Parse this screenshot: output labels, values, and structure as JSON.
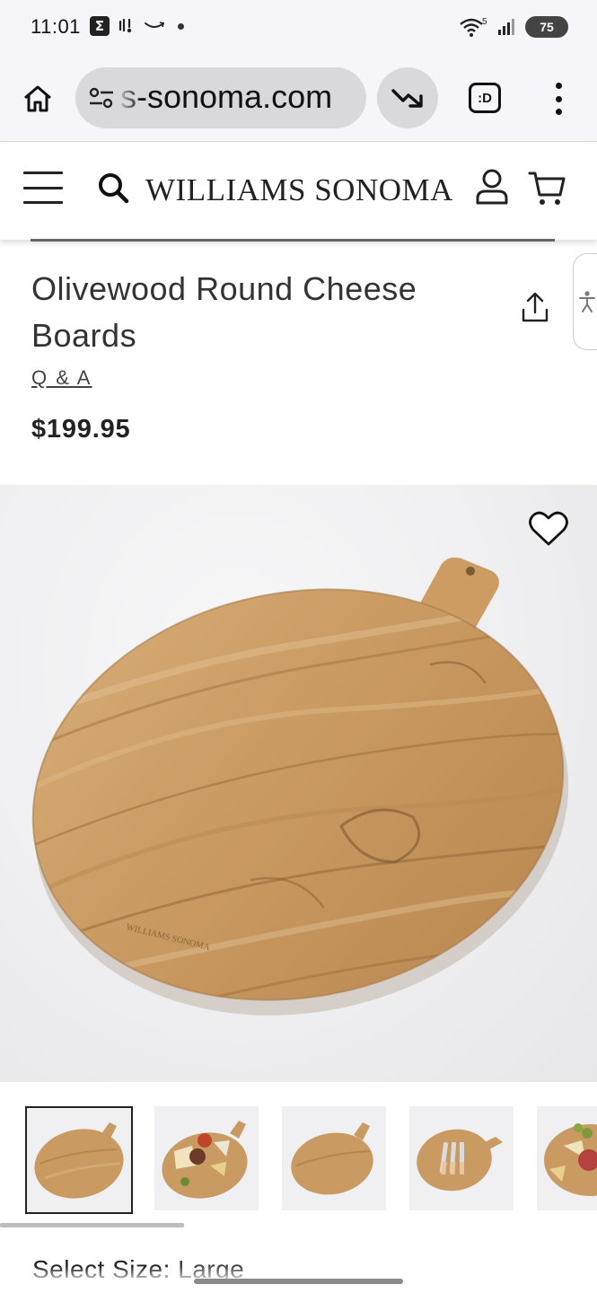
{
  "status_bar": {
    "time": "11:01",
    "battery": "75",
    "wifi_label": "5",
    "icons": [
      "sigma-icon",
      "phone-vibrate-icon",
      "amazon-smile-icon",
      "dot-icon",
      "wifi-icon",
      "signal-icon",
      "battery-icon"
    ]
  },
  "browser": {
    "url_text": "s-sonoma.com",
    "tabs_label": ":D",
    "icons": [
      "home-icon",
      "site-settings-icon",
      "trend-down-icon",
      "tabs-icon",
      "more-vert-icon"
    ]
  },
  "site_header": {
    "brand": "WILLIAMS SONOMA",
    "icons": [
      "menu-icon",
      "search-icon",
      "account-icon",
      "cart-icon"
    ]
  },
  "product": {
    "title": "Olivewood Round Cheese Boards",
    "qa_label": "Q & A",
    "price": "$199.95",
    "image_engraving": "WILLIAMS SONOMA"
  },
  "thumbnails": [
    {
      "name": "board-plain",
      "selected": true
    },
    {
      "name": "board-with-cheese",
      "selected": false
    },
    {
      "name": "board-plain-alt",
      "selected": false
    },
    {
      "name": "board-with-knives",
      "selected": false
    },
    {
      "name": "board-with-charcuterie",
      "selected": false
    }
  ],
  "options": {
    "select_size_label": "Select Size:",
    "select_size_value": "Large"
  },
  "colors": {
    "browser_bg": "#f6f5fa",
    "pill_bg": "#d9d8dd",
    "wood": "#c99a62",
    "text": "#222222"
  }
}
